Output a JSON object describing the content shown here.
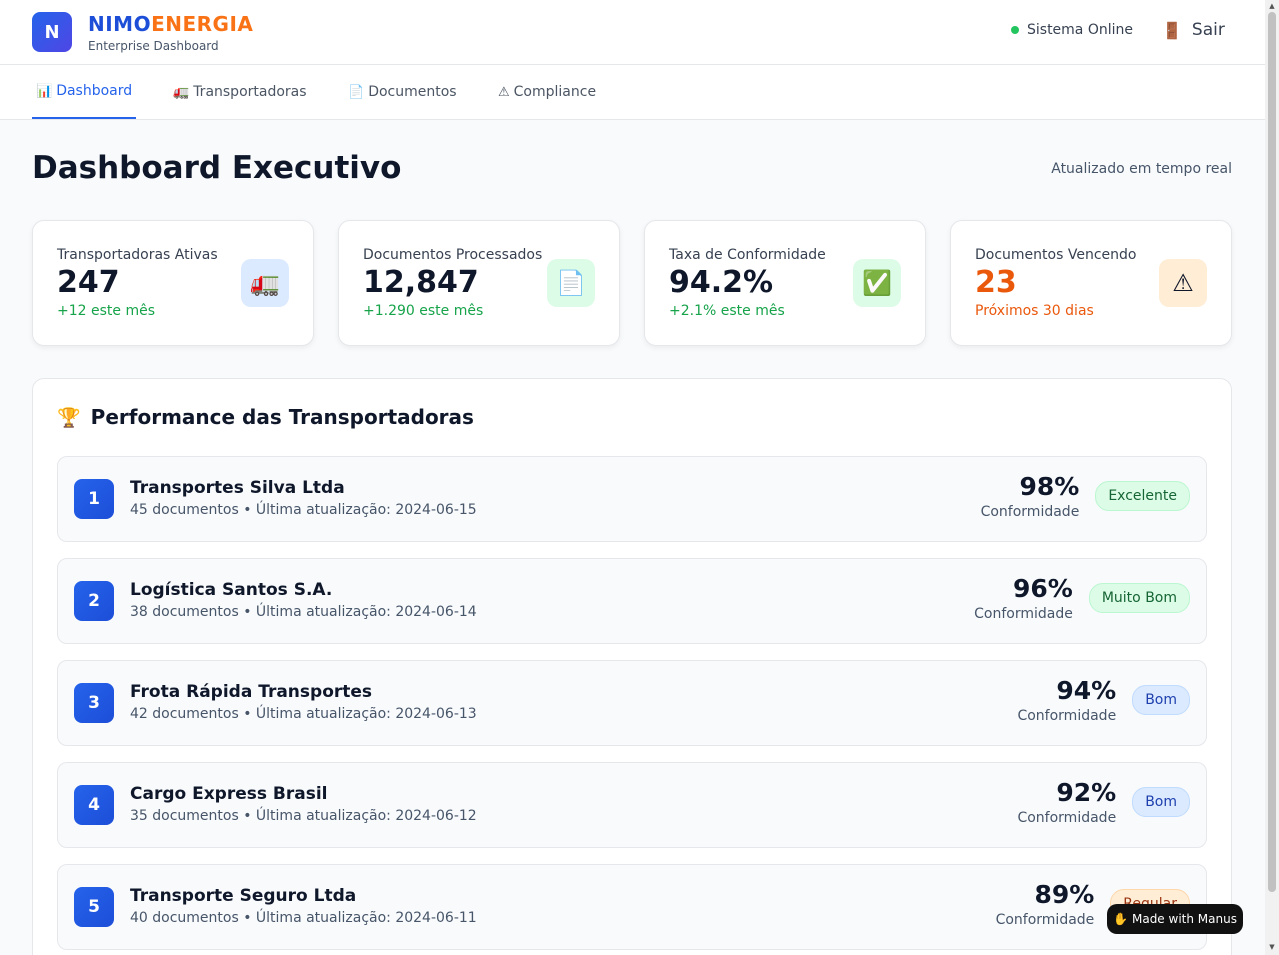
{
  "header": {
    "logo_letter": "N",
    "brand_part1": "NIMO",
    "brand_part2": "ENERGIA",
    "subtitle": "Enterprise Dashboard",
    "status": "Sistema Online",
    "logout_icon": "🚪",
    "logout": "Sair"
  },
  "nav": {
    "tabs": [
      {
        "icon": "📊",
        "label": "Dashboard",
        "active": true
      },
      {
        "icon": "🚛",
        "label": "Transportadoras",
        "active": false
      },
      {
        "icon": "📄",
        "label": "Documentos",
        "active": false
      },
      {
        "icon": "⚠",
        "label": "Compliance",
        "active": false
      }
    ]
  },
  "page": {
    "title": "Dashboard Executivo",
    "updated": "Atualizado em tempo real"
  },
  "stats": [
    {
      "label": "Transportadoras Ativas",
      "value": "247",
      "delta": "+12 este mês",
      "icon": "🚛",
      "icon_name": "truck-icon",
      "accent": "#dbeafe",
      "value_color": "#0f172a",
      "delta_color": "#16a34a"
    },
    {
      "label": "Documentos Processados",
      "value": "12,847",
      "delta": "+1.290 este mês",
      "icon": "📄",
      "icon_name": "document-icon",
      "accent": "#dcfce7",
      "value_color": "#0f172a",
      "delta_color": "#16a34a"
    },
    {
      "label": "Taxa de Conformidade",
      "value": "94.2%",
      "delta": "+2.1% este mês",
      "icon": "✅",
      "icon_name": "check-icon",
      "accent": "#dcfce7",
      "value_color": "#0f172a",
      "delta_color": "#16a34a"
    },
    {
      "label": "Documentos Vencendo",
      "value": "23",
      "delta": "Próximos 30 dias",
      "icon": "⚠",
      "icon_name": "warning-icon",
      "accent": "#ffedd5",
      "value_color": "#ea580c",
      "delta_color": "#ea580c"
    }
  ],
  "performance": {
    "icon": "🏆",
    "title": "Performance das Transportadoras",
    "rows": [
      {
        "rank": "1",
        "name": "Transportes Silva Ltda",
        "meta": "45 documentos • Última atualização: 2024-06-15",
        "pct": "98%",
        "pct_label": "Conformidade",
        "badge": "Excelente",
        "badge_class": "excelente"
      },
      {
        "rank": "2",
        "name": "Logística Santos S.A.",
        "meta": "38 documentos • Última atualização: 2024-06-14",
        "pct": "96%",
        "pct_label": "Conformidade",
        "badge": "Muito Bom",
        "badge_class": "muito-bom"
      },
      {
        "rank": "3",
        "name": "Frota Rápida Transportes",
        "meta": "42 documentos • Última atualização: 2024-06-13",
        "pct": "94%",
        "pct_label": "Conformidade",
        "badge": "Bom",
        "badge_class": "bom"
      },
      {
        "rank": "4",
        "name": "Cargo Express Brasil",
        "meta": "35 documentos • Última atualização: 2024-06-12",
        "pct": "92%",
        "pct_label": "Conformidade",
        "badge": "Bom",
        "badge_class": "bom"
      },
      {
        "rank": "5",
        "name": "Transporte Seguro Ltda",
        "meta": "40 documentos • Última atualização: 2024-06-11",
        "pct": "89%",
        "pct_label": "Conformidade",
        "badge": "Regular",
        "badge_class": "regular"
      }
    ]
  },
  "manus": {
    "icon": "✋",
    "label": "Made with Manus"
  }
}
